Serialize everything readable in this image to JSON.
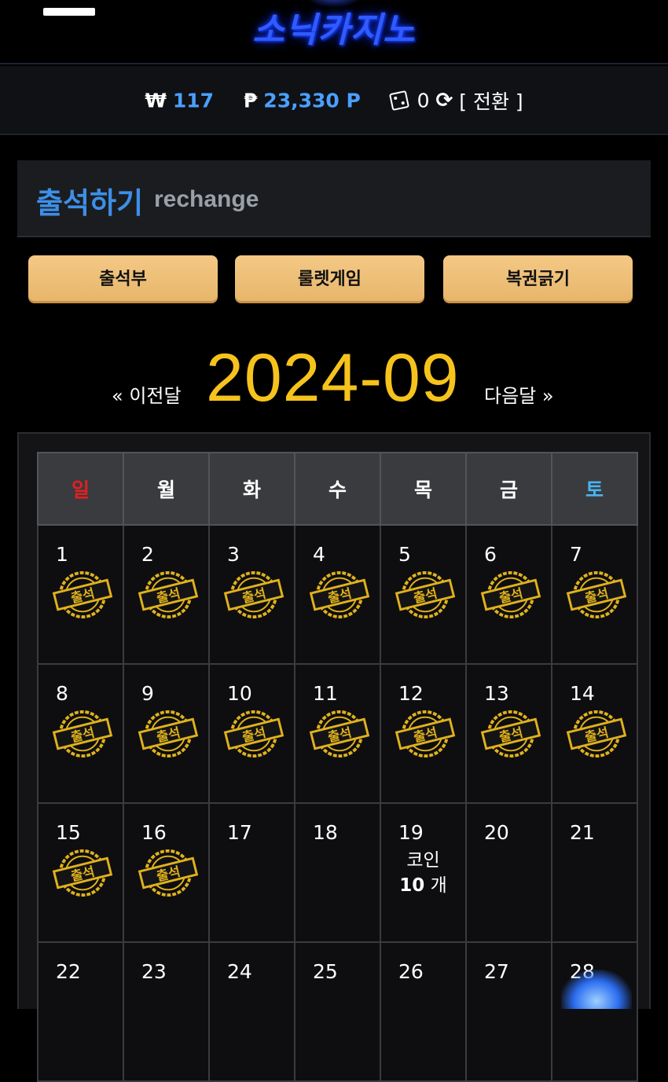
{
  "header": {
    "logo_text": "소닉카지노"
  },
  "wallet": {
    "won_symbol": "₩",
    "won_value": "117",
    "point_symbol": "₱",
    "point_value": "23,330 P",
    "chip_value": "0",
    "convert_label": "[ 전환 ]"
  },
  "page": {
    "title": "출석하기",
    "subtitle": "rechange"
  },
  "buttons": {
    "attendance": "출석부",
    "roulette": "룰렛게임",
    "lottery": "복권긁기"
  },
  "month_nav": {
    "prev": "« 이전달",
    "current": "2024-09",
    "next": "다음달 »"
  },
  "calendar": {
    "weekdays": [
      "일",
      "월",
      "화",
      "수",
      "목",
      "금",
      "토"
    ],
    "stamp_text": "출석",
    "weeks": [
      [
        {
          "day": "1",
          "attended": true
        },
        {
          "day": "2",
          "attended": true
        },
        {
          "day": "3",
          "attended": true
        },
        {
          "day": "4",
          "attended": true
        },
        {
          "day": "5",
          "attended": true
        },
        {
          "day": "6",
          "attended": true
        },
        {
          "day": "7",
          "attended": true
        }
      ],
      [
        {
          "day": "8",
          "attended": true
        },
        {
          "day": "9",
          "attended": true
        },
        {
          "day": "10",
          "attended": true
        },
        {
          "day": "11",
          "attended": true
        },
        {
          "day": "12",
          "attended": true
        },
        {
          "day": "13",
          "attended": true
        },
        {
          "day": "14",
          "attended": true
        }
      ],
      [
        {
          "day": "15",
          "attended": true
        },
        {
          "day": "16",
          "attended": true
        },
        {
          "day": "17",
          "attended": false
        },
        {
          "day": "18",
          "attended": false
        },
        {
          "day": "19",
          "attended": false,
          "reward_label": "코인",
          "reward_amount": "10",
          "reward_unit": "개"
        },
        {
          "day": "20",
          "attended": false
        },
        {
          "day": "21",
          "attended": false
        }
      ],
      [
        {
          "day": "22",
          "attended": false
        },
        {
          "day": "23",
          "attended": false
        },
        {
          "day": "24",
          "attended": false
        },
        {
          "day": "25",
          "attended": false
        },
        {
          "day": "26",
          "attended": false
        },
        {
          "day": "27",
          "attended": false
        },
        {
          "day": "28",
          "attended": false
        }
      ]
    ]
  },
  "colors": {
    "accent_blue": "#3d8fe8",
    "gold": "#f6c31c",
    "button": "#e6b56a"
  }
}
